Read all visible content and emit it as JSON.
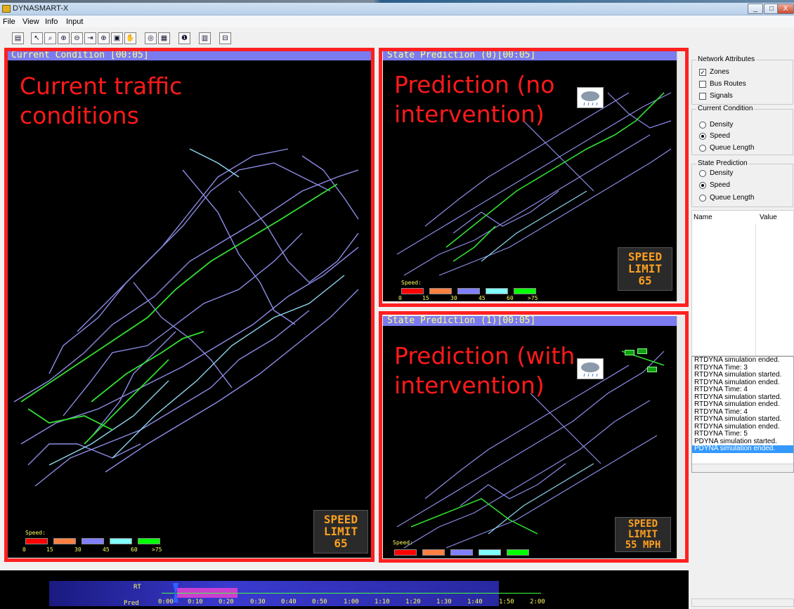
{
  "window": {
    "title": "DYNASMART-X",
    "controls": [
      "_",
      "□",
      "X"
    ]
  },
  "menu": [
    "File",
    "View",
    "Info",
    "Input"
  ],
  "toolbar": [
    "select-icon",
    "zoom-icon",
    "zoom-in-icon",
    "zoom-out-icon",
    "pan-right-icon",
    "zoom-window-icon",
    "fit-icon",
    "hand-icon",
    "stop-icon",
    "save-icon",
    "info-icon",
    "chart-icon",
    "export-icon"
  ],
  "panels": {
    "current": {
      "header": "Current Condition [00:05]",
      "annotation": "Current traffic\nconditions",
      "sign": "SPEED\nLIMIT\n65"
    },
    "pred0": {
      "header": "State Prediction (0)[00:05]",
      "annotation": "Prediction (no\nintervention)",
      "sign": "SPEED\nLIMIT\n65"
    },
    "pred1": {
      "header": "State Prediction (1)[00:05]",
      "annotation": "Prediction (with\nintervention)",
      "sign": "SPEED\nLIMIT\n55 MPH"
    }
  },
  "legend": {
    "title": "Speed:",
    "ticks": [
      "0",
      "15",
      "30",
      "45",
      "60",
      ">75"
    ],
    "colors": [
      "#ff0000",
      "#ff8040",
      "#8080ff",
      "#80ffff",
      "#00ff00"
    ]
  },
  "sidebar": {
    "network_title": "Network Attributes",
    "zones": "Zones",
    "bus_routes": "Bus Routes",
    "signals": "Signals",
    "current_title": "Current Condition",
    "state_title": "State Prediction",
    "density": "Density",
    "speed": "Speed",
    "queue": "Queue Length",
    "col_name": "Name",
    "col_value": "Value"
  },
  "log": [
    "RTDYNA simulation ended.",
    "RTDYNA Time: 3",
    "RTDYNA simulation started.",
    "RTDYNA simulation ended.",
    "RTDYNA Time: 4",
    "RTDYNA simulation started.",
    "RTDYNA simulation ended.",
    "RTDYNA Time: 4",
    "RTDYNA simulation started.",
    "RTDYNA simulation ended.",
    "RTDYNA Time: 5",
    "PDYNA simulation started.",
    "PDYNA simulation ended."
  ],
  "timeline": {
    "rt_label": "RT",
    "pred_label": "Pred",
    "times": [
      "0:00",
      "0:10",
      "0:20",
      "0:30",
      "0:40",
      "0:50",
      "1:00",
      "1:10",
      "1:20",
      "1:30",
      "1:40",
      "1:50",
      "2:00"
    ]
  }
}
